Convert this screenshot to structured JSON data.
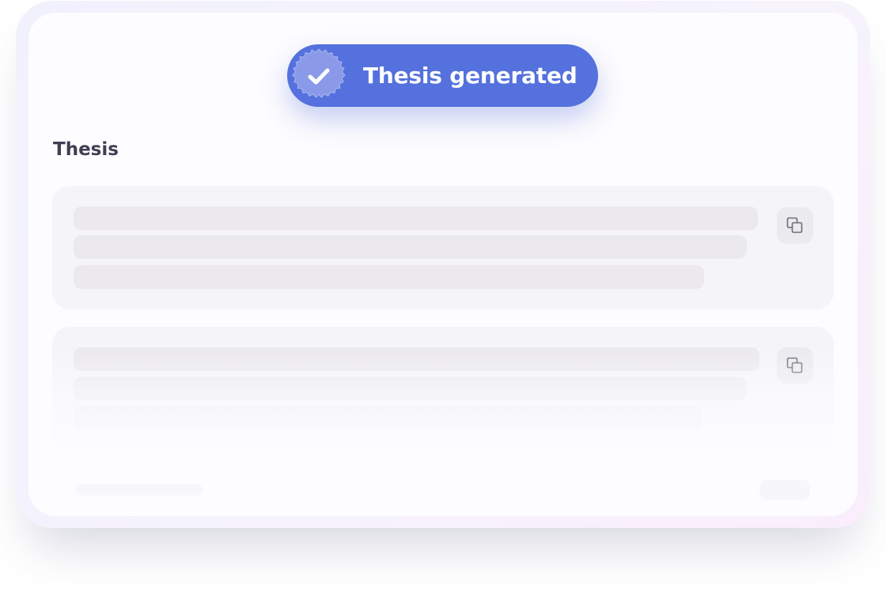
{
  "toast": {
    "label": "Thesis generated",
    "icon": "checkmark-badge-icon",
    "color": "#5471dd"
  },
  "section": {
    "title": "Thesis"
  },
  "results": [
    {
      "copy_icon": "copy-icon"
    },
    {
      "copy_icon": "copy-icon"
    }
  ]
}
